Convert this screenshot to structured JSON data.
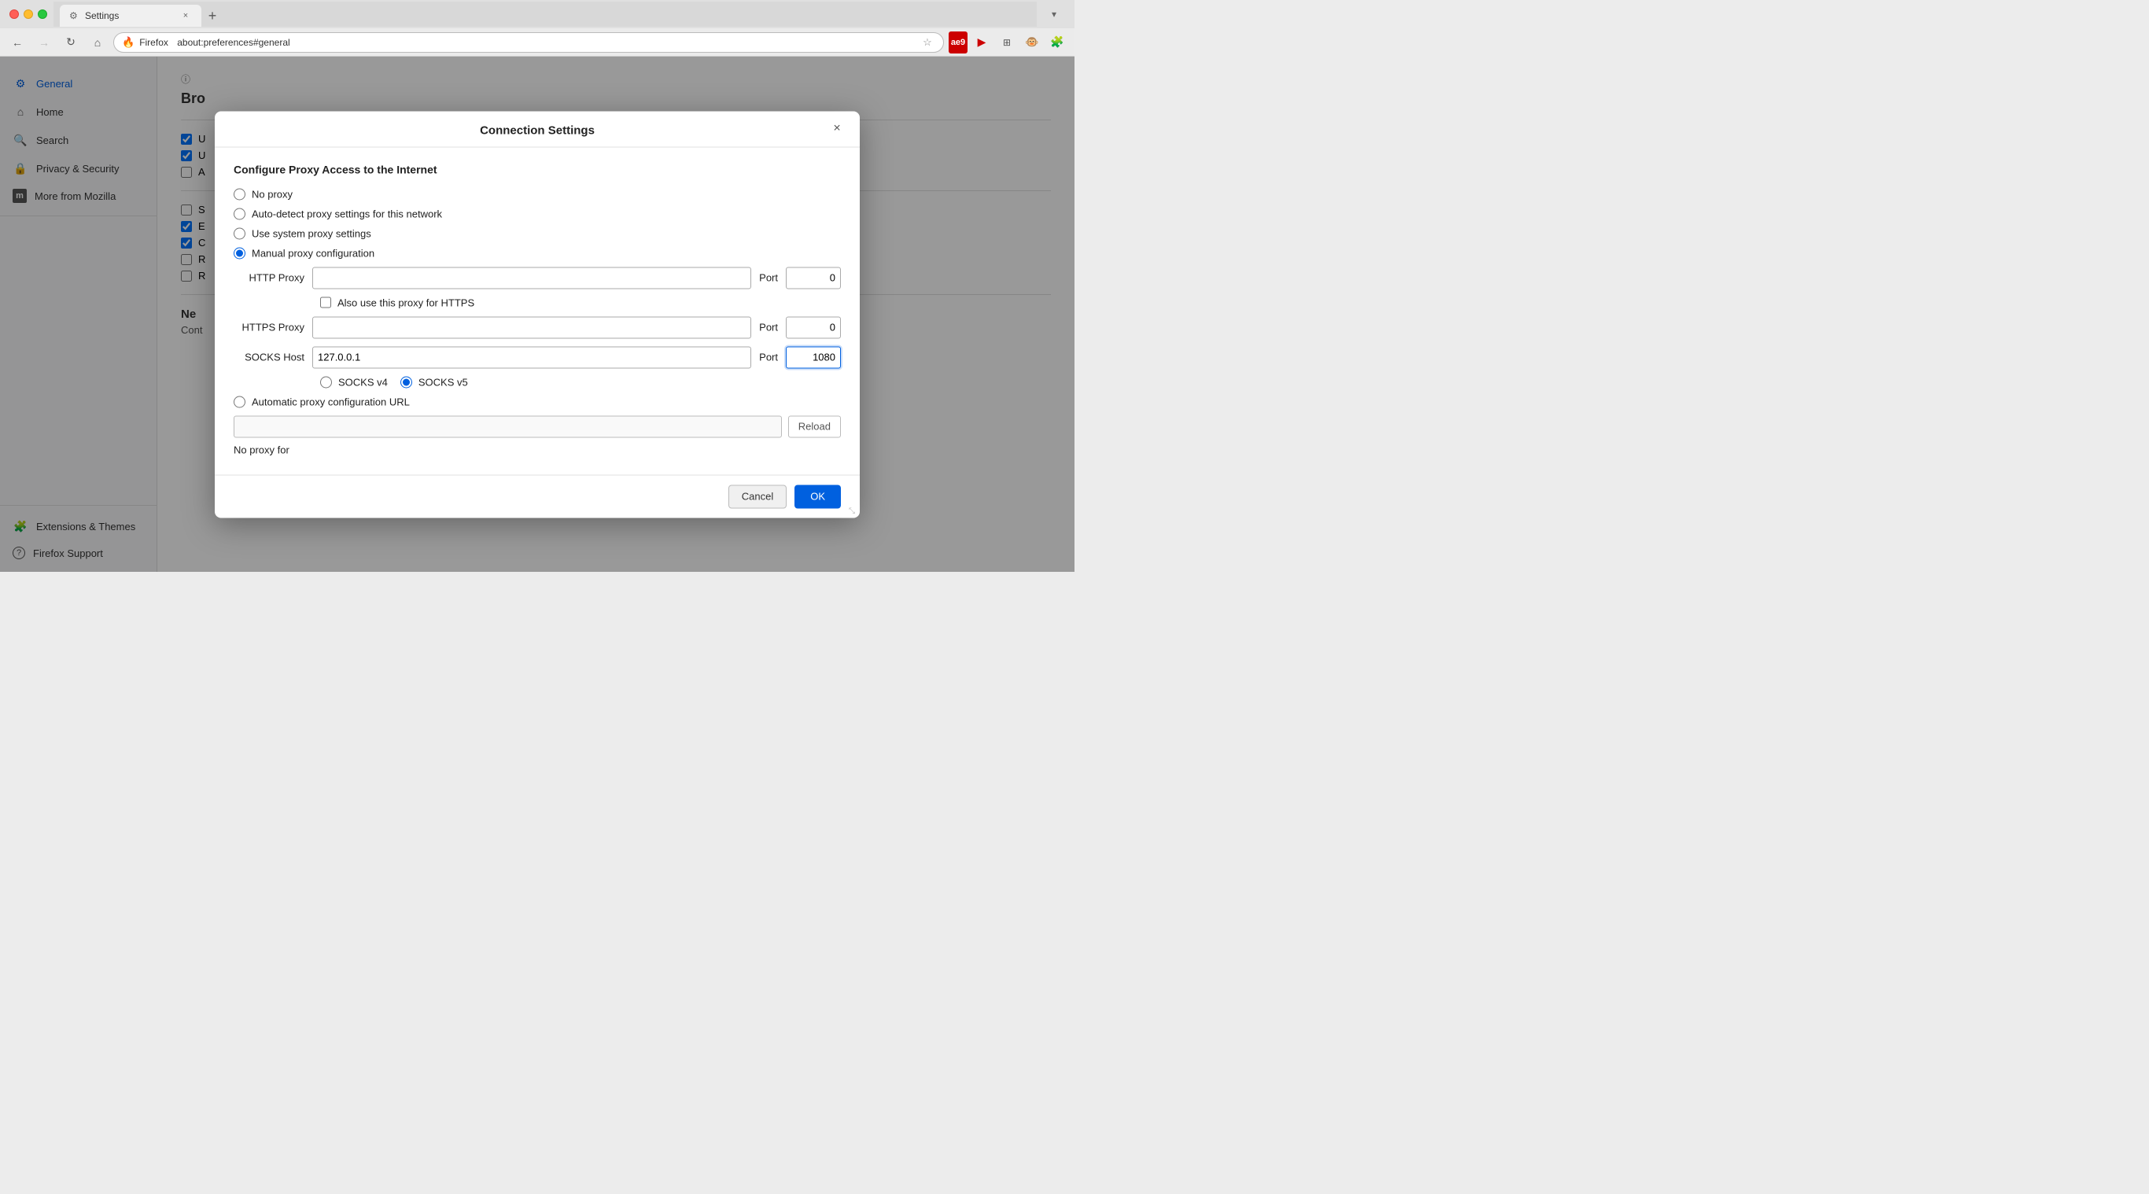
{
  "browser": {
    "tab_label": "Settings",
    "new_tab_label": "+",
    "address": "about:preferences#general",
    "address_prefix": "Firefox",
    "back_arrow": "←",
    "forward_arrow": "→",
    "reload_icon": "↻",
    "home_icon": "⌂"
  },
  "sidebar": {
    "items": [
      {
        "id": "general",
        "label": "General",
        "icon": "⚙",
        "active": true
      },
      {
        "id": "home",
        "label": "Home",
        "icon": "⌂",
        "active": false
      },
      {
        "id": "search",
        "label": "Search",
        "icon": "🔍",
        "active": false
      },
      {
        "id": "privacy",
        "label": "Privacy & Security",
        "icon": "🔒",
        "active": false
      },
      {
        "id": "more",
        "label": "More from Mozilla",
        "icon": "Ⓜ",
        "active": false
      }
    ],
    "bottom_items": [
      {
        "id": "extensions",
        "label": "Extensions & Themes",
        "icon": "🧩"
      },
      {
        "id": "support",
        "label": "Firefox Support",
        "icon": "?"
      }
    ]
  },
  "settings_page": {
    "browser_section_title": "Bro",
    "network_section_title": "Ne",
    "network_label": "Cont",
    "checkboxes": [
      {
        "checked": true,
        "label": "U"
      },
      {
        "checked": true,
        "label": "U"
      },
      {
        "checked": false,
        "label": "A"
      },
      {
        "checked": false,
        "label": "S"
      },
      {
        "checked": true,
        "label": "E"
      },
      {
        "checked": true,
        "label": "C"
      },
      {
        "checked": false,
        "label": "R"
      },
      {
        "checked": false,
        "label": "R"
      }
    ]
  },
  "modal": {
    "title": "Connection Settings",
    "section_title": "Configure Proxy Access to the Internet",
    "close_label": "×",
    "proxy_options": [
      {
        "id": "no-proxy",
        "label": "No proxy",
        "checked": false
      },
      {
        "id": "auto-detect",
        "label": "Auto-detect proxy settings for this network",
        "checked": false
      },
      {
        "id": "system-proxy",
        "label": "Use system proxy settings",
        "checked": false
      },
      {
        "id": "manual-proxy",
        "label": "Manual proxy configuration",
        "checked": true
      }
    ],
    "http_proxy_label": "HTTP Proxy",
    "http_proxy_value": "",
    "http_port_label": "Port",
    "http_port_value": "0",
    "also_https_label": "Also use this proxy for HTTPS",
    "also_https_checked": false,
    "https_proxy_label": "HTTPS Proxy",
    "https_proxy_value": "",
    "https_port_label": "Port",
    "https_port_value": "0",
    "socks_host_label": "SOCKS Host",
    "socks_host_value": "127.0.0.1",
    "socks_port_label": "Port",
    "socks_port_value": "1080",
    "socks_v4_label": "SOCKS v4",
    "socks_v5_label": "SOCKS v5",
    "socks_v4_checked": false,
    "socks_v5_checked": true,
    "auto_proxy_label": "Automatic proxy configuration URL",
    "auto_proxy_checked": false,
    "auto_proxy_url_value": "",
    "reload_btn_label": "Reload",
    "no_proxy_label": "No proxy for",
    "cancel_label": "Cancel",
    "ok_label": "OK"
  },
  "colors": {
    "accent": "#0060df",
    "active_sidebar": "#0060df"
  }
}
